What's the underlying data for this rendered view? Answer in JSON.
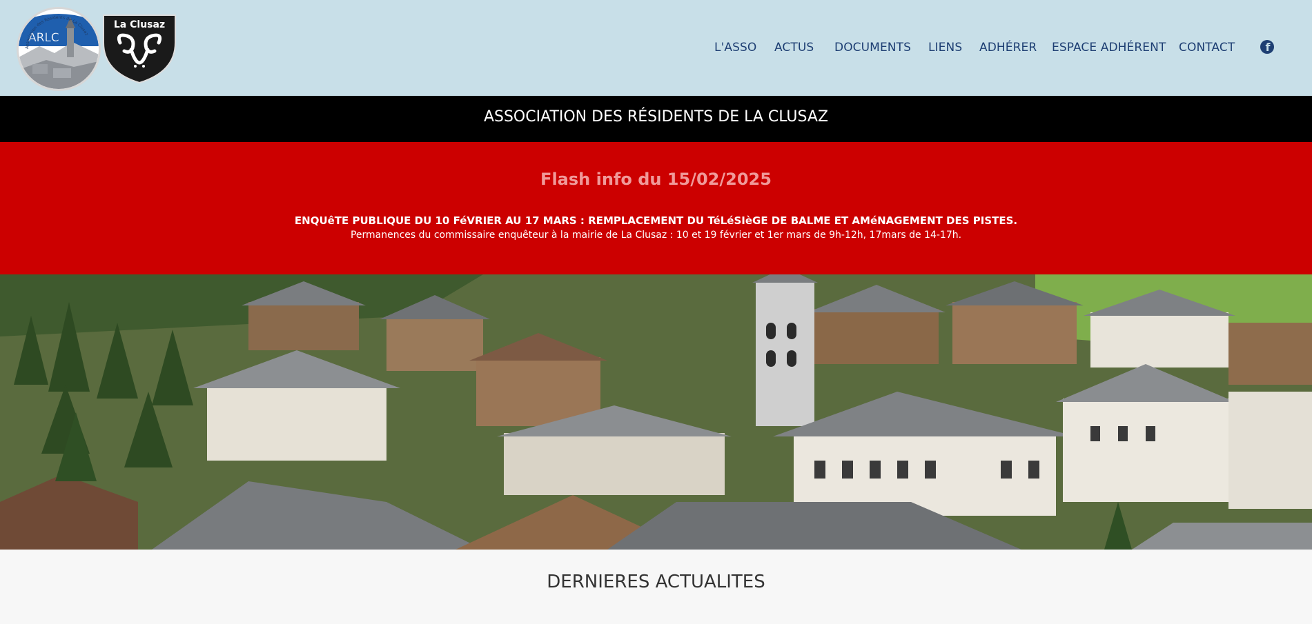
{
  "logos": {
    "arlc_text": "ARLC",
    "arlc_ring_text": "Association des Résidents de La Clusaz",
    "clusaz_text": "La Clusaz"
  },
  "nav": {
    "items": [
      {
        "label": "L'ASSO"
      },
      {
        "label": "ACTUS"
      },
      {
        "label": "DOCUMENTS"
      },
      {
        "label": "LIENS"
      },
      {
        "label": "ADHÉRER"
      },
      {
        "label": "ESPACE ADHÉRENT"
      },
      {
        "label": "CONTACT"
      }
    ],
    "facebook_icon": "facebook-icon",
    "facebook_glyph": "f"
  },
  "title_bar": {
    "title": "ASSOCIATION DES RÉSIDENTS DE LA CLUSAZ"
  },
  "flash": {
    "title": "Flash info du 15/02/2025",
    "line1": "ENQUêTE PUBLIQUE DU 10 FéVRIER AU 17 MARS : REMPLACEMENT DU TéLéSIèGE DE BALME ET AMéNAGEMENT DES PISTES.",
    "line2": "Permanences du  commissaire enquêteur à la mairie de La Clusaz : 10 et 19 février et 1er mars de 9h-12h, 17mars de 14-17h."
  },
  "news": {
    "title": "DERNIERES ACTUALITES"
  },
  "colors": {
    "header_bg": "#c8dfe8",
    "nav_text": "#1e3f73",
    "title_bar_bg": "#000000",
    "flash_bg": "#cc0000",
    "flash_title": "#f09a9a"
  }
}
